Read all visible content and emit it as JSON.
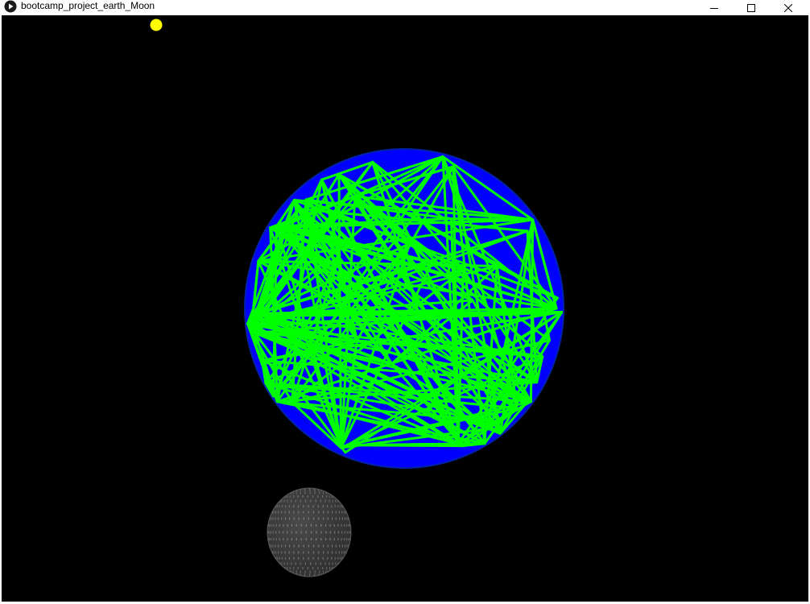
{
  "window": {
    "title": "bootcamp_project_earth_Moon",
    "app_icon": "processing-play-icon",
    "controls": {
      "minimize_icon": "minimize-icon",
      "maximize_icon": "maximize-icon",
      "close_icon": "close-icon"
    }
  },
  "scene": {
    "background_color": "#000000",
    "sun": {
      "name": "sun",
      "color": "#ffff00"
    },
    "earth": {
      "name": "earth",
      "fill_color": "#0000ff",
      "outline_color": "#0022aa",
      "wire_color": "#00ff00"
    },
    "moon": {
      "name": "moon",
      "fill_color": "#3c3c3c",
      "dot_color": "#8a8a8a"
    }
  }
}
